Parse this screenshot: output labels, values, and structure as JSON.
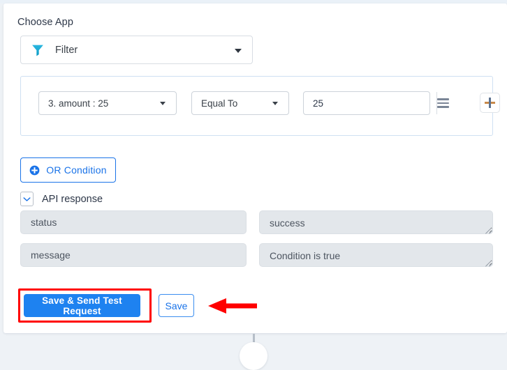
{
  "app": {
    "choose_app_label": "Choose App",
    "selected_app": "Filter",
    "app_icon": "funnel-icon",
    "dropdown_icon": "caret-down-icon"
  },
  "condition": {
    "field": "3. amount : 25",
    "operator": "Equal To",
    "value": "25",
    "value_placeholder": "",
    "list_icon": "hamburger-icon",
    "add_icon": "plus-icon"
  },
  "or_condition": {
    "label": "OR Condition",
    "icon": "plus-circle-icon"
  },
  "api_response": {
    "title": "API response",
    "toggle_icon": "chevron-down-icon",
    "rows": [
      {
        "key": "status",
        "value": "success"
      },
      {
        "key": "message",
        "value": "Condition is true"
      }
    ]
  },
  "footer": {
    "primary_label": "Save & Send Test Request",
    "secondary_label": "Save"
  },
  "annotations": {
    "highlight_color": "#ff0000",
    "arrow_color": "#ff0000",
    "accent_color": "#1e82f0",
    "link_color": "#1a73e8"
  }
}
